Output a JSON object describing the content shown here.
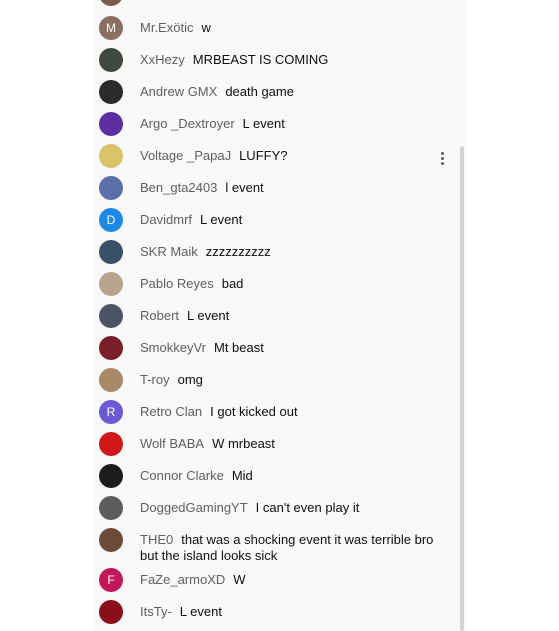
{
  "messages": [
    {
      "author": "Mr.Exötic",
      "text": "w",
      "avatar_letter": "M",
      "avatar_color": "#8d6e63"
    },
    {
      "author": "XxHezy",
      "text": "MRBEAST IS COMING",
      "avatar_color": "#3e4a3f"
    },
    {
      "author": "Andrew GMX",
      "text": "death game",
      "avatar_color": "#2b2b2b"
    },
    {
      "author": "Argo _Dextroyer",
      "text": "L event",
      "avatar_color": "#5b2fa0"
    },
    {
      "author": "Voltage _PapaJ",
      "text": "LUFFY?",
      "avatar_color": "#d9c46a"
    },
    {
      "author": "Ben_gta2403",
      "text": "l event",
      "avatar_color": "#5a6fa8"
    },
    {
      "author": "Davidmrf",
      "text": "L event",
      "avatar_letter": "D",
      "avatar_color": "#1e88e5"
    },
    {
      "author": "SKR Maik",
      "text": "zzzzzzzzzz",
      "avatar_color": "#3b5266"
    },
    {
      "author": "Pablo Reyes",
      "text": "bad",
      "avatar_color": "#b8a48e"
    },
    {
      "author": "Robert",
      "text": "L event",
      "avatar_color": "#4a5566"
    },
    {
      "author": "SmokkeyVr",
      "text": "Mt beast",
      "avatar_color": "#7a1f2a"
    },
    {
      "author": "T-roy",
      "text": "omg",
      "avatar_color": "#a88a66"
    },
    {
      "author": "Retro Clan",
      "text": "I got kicked out",
      "avatar_letter": "R",
      "avatar_color": "#6a5ad6"
    },
    {
      "author": "Wolf BABA",
      "text": "W mrbeast",
      "avatar_color": "#d01818"
    },
    {
      "author": "Connor Clarke",
      "text": "Mid",
      "avatar_color": "#1c1c1c"
    },
    {
      "author": "DoggedGamingYT",
      "text": "I can't even play it",
      "avatar_color": "#5c5c5c"
    },
    {
      "author": "THE0",
      "text": "that was a shocking event it was terrible bro but the island looks sick",
      "avatar_color": "#6e4a3a"
    },
    {
      "author": "FaZe_armoXD",
      "text": "W",
      "avatar_letter": "F",
      "avatar_color": "#c2185b"
    },
    {
      "author": "ItsTy-",
      "text": "L event",
      "avatar_color": "#8b0f1a"
    }
  ]
}
